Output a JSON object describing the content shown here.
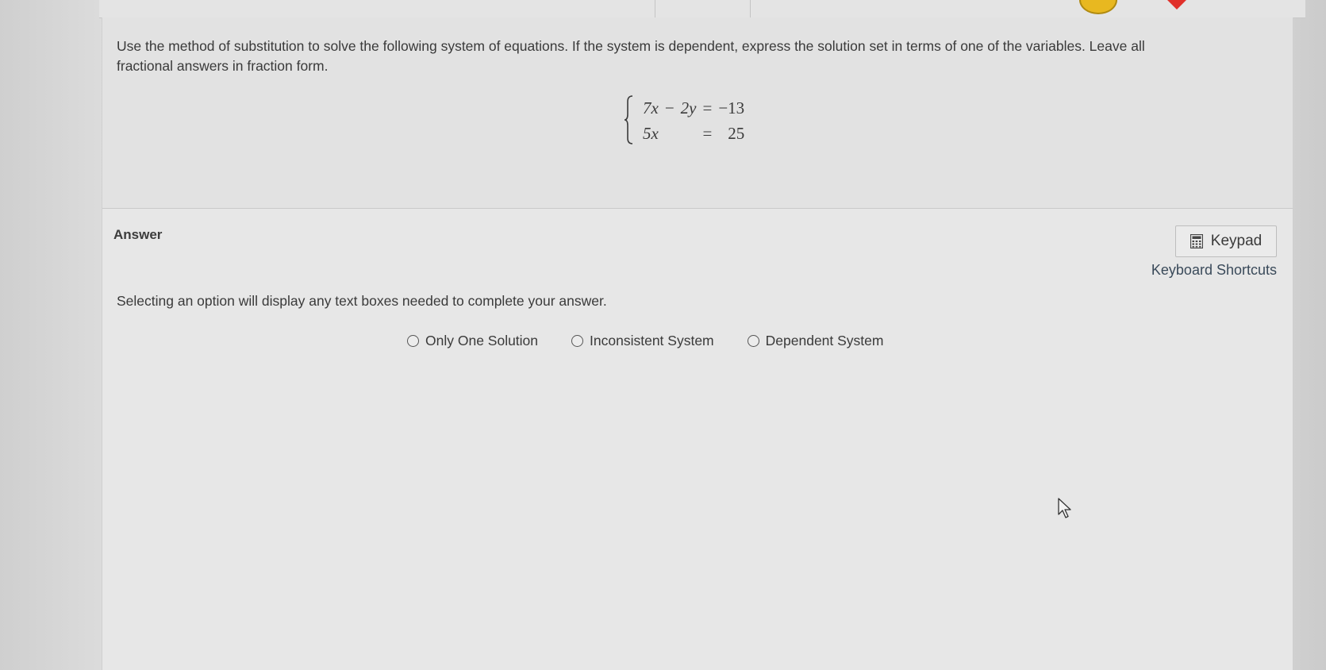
{
  "question": {
    "prompt_line1": "Use the method of substitution to solve the following system of equations. If the system is dependent, express the solution set in terms of one of the variables. Leave all",
    "prompt_line2": "fractional answers in fraction form.",
    "system": {
      "row1": {
        "lhs_a": "7x",
        "op": "−",
        "lhs_b": "2y",
        "eq": "=",
        "rhs": "−13"
      },
      "row2": {
        "lhs_a": "5x",
        "op": "",
        "lhs_b": "",
        "eq": "=",
        "rhs": "25"
      }
    }
  },
  "answer": {
    "label": "Answer",
    "keypad_label": "Keypad",
    "shortcuts_label": "Keyboard Shortcuts",
    "instruction": "Selecting an option will display any text boxes needed to complete your answer.",
    "options": [
      {
        "label": "Only One Solution",
        "selected": false
      },
      {
        "label": "Inconsistent System",
        "selected": false
      },
      {
        "label": "Dependent System",
        "selected": false
      }
    ]
  },
  "colors": {
    "coin": "#e8b820",
    "heart": "#e0302a"
  },
  "icons": [
    "calculator-icon",
    "radio-button-icon",
    "mouse-cursor-icon",
    "coin-icon",
    "heart-icon"
  ]
}
